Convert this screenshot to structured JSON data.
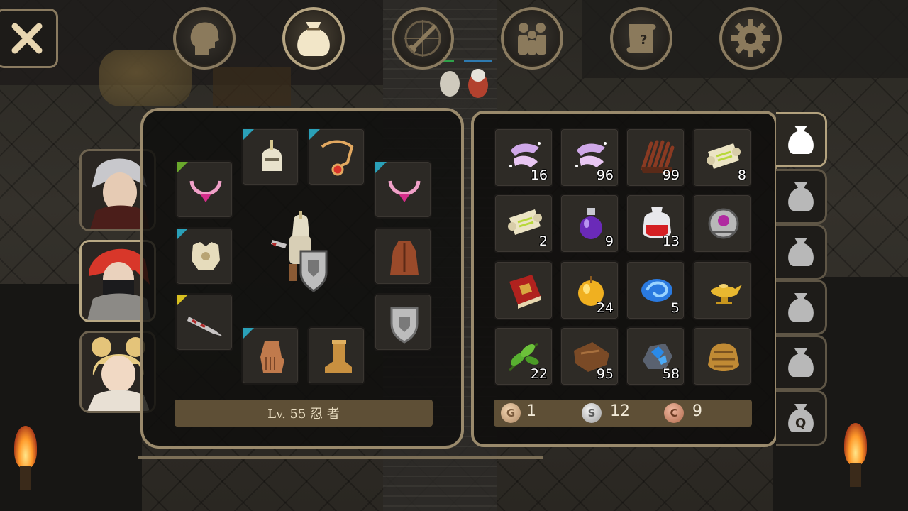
{
  "top_menu": {
    "buttons": [
      {
        "id": "character",
        "icon": "head-icon"
      },
      {
        "id": "inventory",
        "icon": "bag-icon",
        "active": true
      },
      {
        "id": "skills",
        "icon": "sword-compass-icon"
      },
      {
        "id": "party",
        "icon": "people-icon"
      },
      {
        "id": "quest",
        "icon": "scroll-question-icon"
      },
      {
        "id": "settings",
        "icon": "gear-icon"
      }
    ]
  },
  "party": {
    "members": [
      {
        "name_icon": "white-haired-warrior-portrait"
      },
      {
        "name_icon": "red-haired-ninja-portrait",
        "active": true
      },
      {
        "name_icon": "blonde-girl-portrait"
      }
    ]
  },
  "equipment": {
    "level_label": "Lv. 55 忍 者",
    "slots": [
      {
        "icon": "ruby-necklace-icon",
        "quality": "green"
      },
      {
        "icon": "helmet-icon",
        "quality": "blue"
      },
      {
        "icon": "amulet-chain-icon",
        "quality": "blue"
      },
      {
        "icon": "ruby-necklace-icon",
        "quality": "blue"
      },
      {
        "icon": "armor-icon",
        "quality": "blue"
      },
      {
        "icon": "cloak-icon",
        "quality": ""
      },
      {
        "icon": "dagger-icon",
        "quality": "yellow"
      },
      {
        "icon": "shield-icon",
        "quality": ""
      },
      {
        "icon": "glove-icon",
        "quality": "blue"
      },
      {
        "icon": "boot-icon",
        "quality": ""
      }
    ]
  },
  "inventory": {
    "items": [
      {
        "icon": "crystal-ribbon-icon",
        "qty": "16"
      },
      {
        "icon": "crystal-ribbon-icon",
        "qty": "96"
      },
      {
        "icon": "feather-bundle-icon",
        "qty": "99"
      },
      {
        "icon": "scroll-icon",
        "qty": "8"
      },
      {
        "icon": "scroll-icon",
        "qty": "2"
      },
      {
        "icon": "purple-potion-icon",
        "qty": "9"
      },
      {
        "icon": "red-potion-icon",
        "qty": "13"
      },
      {
        "icon": "ornate-orb-icon",
        "qty": ""
      },
      {
        "icon": "red-book-icon",
        "qty": ""
      },
      {
        "icon": "golden-apple-icon",
        "qty": "24"
      },
      {
        "icon": "blue-swirl-icon",
        "qty": "5"
      },
      {
        "icon": "magic-lamp-icon",
        "qty": ""
      },
      {
        "icon": "green-leaf-icon",
        "qty": "22"
      },
      {
        "icon": "leather-hide-icon",
        "qty": "95"
      },
      {
        "icon": "blue-ore-icon",
        "qty": "58"
      },
      {
        "icon": "gold-wrap-icon",
        "qty": ""
      }
    ],
    "currency": {
      "gold": {
        "letter": "G",
        "value": "1"
      },
      "silver": {
        "letter": "S",
        "value": "12"
      },
      "copper": {
        "letter": "C",
        "value": "9"
      }
    },
    "bag_tabs": [
      {
        "icon": "bag-icon",
        "active": true
      },
      {
        "icon": "bag-icon"
      },
      {
        "icon": "bag-icon"
      },
      {
        "icon": "bag-icon"
      },
      {
        "icon": "bag-icon"
      },
      {
        "icon": "quest-bag-icon",
        "letter": "Q"
      }
    ]
  },
  "colors": {
    "frame": "#9a8a6c",
    "panel_bg": "#0e0d0c",
    "label_bar": "#5e4f36",
    "quality_blue": "#2aa0b8",
    "quality_yellow": "#d8c020",
    "quality_green": "#6aa82c"
  }
}
